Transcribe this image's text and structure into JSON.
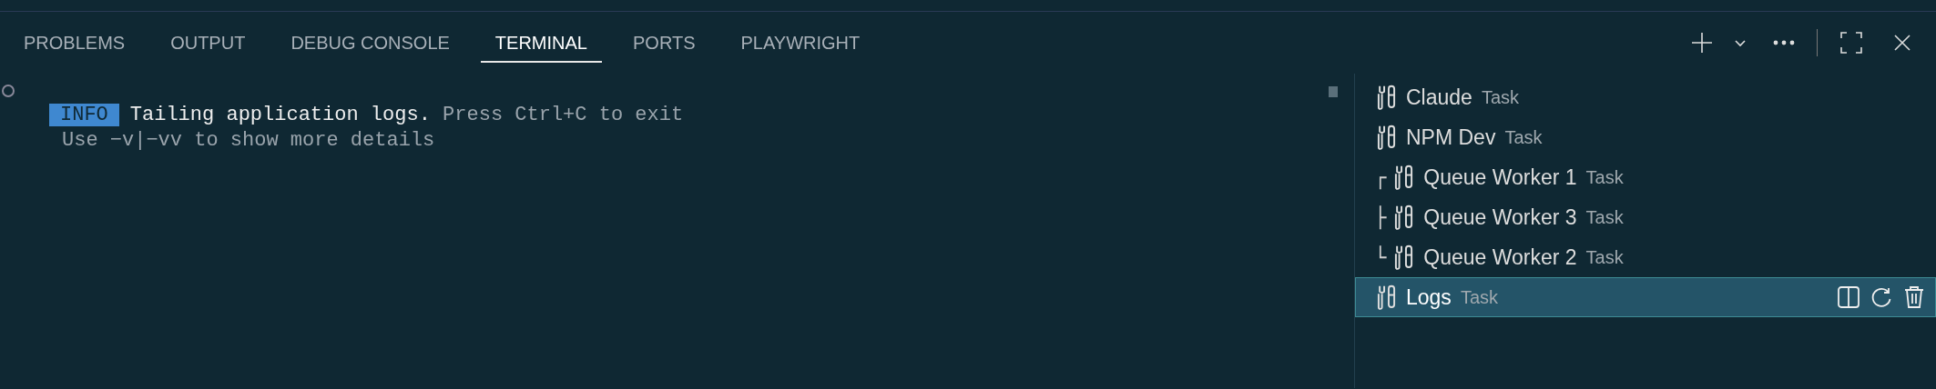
{
  "tabs": [
    {
      "label": "PROBLEMS",
      "selected": false
    },
    {
      "label": "OUTPUT",
      "selected": false
    },
    {
      "label": "DEBUG CONSOLE",
      "selected": false
    },
    {
      "label": "TERMINAL",
      "selected": true
    },
    {
      "label": "PORTS",
      "selected": false
    },
    {
      "label": "PLAYWRIGHT",
      "selected": false
    }
  ],
  "terminal": {
    "badge": "INFO",
    "message": "Tailing application logs.",
    "hint": "Press Ctrl+C to exit",
    "line2": "Use −v|−vv to show more details"
  },
  "terminals": [
    {
      "name": "Claude",
      "kind_label": "Task",
      "selected": false
    },
    {
      "name": "NPM Dev",
      "kind_label": "Task",
      "selected": false
    },
    {
      "prefix": "┌",
      "name": "Queue Worker 1",
      "kind_label": "Task",
      "selected": false
    },
    {
      "prefix": "├",
      "name": "Queue Worker 3",
      "kind_label": "Task",
      "selected": false
    },
    {
      "prefix": "└",
      "name": "Queue Worker 2",
      "kind_label": "Task",
      "selected": false
    },
    {
      "name": "Logs",
      "kind_label": "Task",
      "selected": true
    }
  ]
}
